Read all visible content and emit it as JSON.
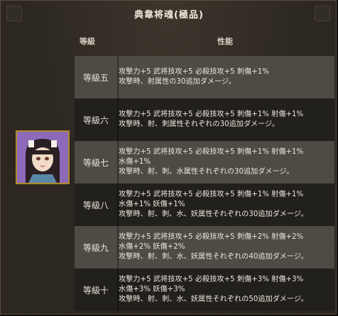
{
  "window": {
    "title": "典韋将魂(極品)"
  },
  "headers": {
    "level": "等級",
    "performance": "性能"
  },
  "portrait": {
    "icon": "character-portrait-icon"
  },
  "rows": [
    {
      "level": "等級五",
      "lines": [
        "攻撃力+5 武将技攻+5 必殺技攻+5 刺傷+1%",
        "攻撃時、射属性の30追加ダメージ。"
      ]
    },
    {
      "level": "等級六",
      "lines": [
        "攻撃力+5 武将技攻+5 必殺技攻+5 刺傷+1% 射傷+1%",
        "攻撃時、射、刺属性それぞれの30追加ダメージ。"
      ]
    },
    {
      "level": "等級七",
      "lines": [
        "攻撃力+5 武将技攻+5 必殺技攻+5 刺傷+1% 射傷+1%",
        "水傷+1%",
        "攻撃時、射、刺、水属性それぞれの30追加ダメージ。"
      ]
    },
    {
      "level": "等級八",
      "lines": [
        "攻撃力+5 武将技攻+5 必殺技攻+5 刺傷+1% 射傷+1%",
        "水傷+1% 妖傷+1%",
        "攻撃時、射、刺、水、妖属性それぞれの30追加ダメージ。"
      ]
    },
    {
      "level": "等級九",
      "lines": [
        "攻撃力+5 武将技攻+5 必殺技攻+5 刺傷+2% 射傷+2%",
        "水傷+2% 妖傷+2%",
        "攻撃時、射、刺、水、妖属性それぞれの40追加ダメージ。"
      ]
    },
    {
      "level": "等級十",
      "lines": [
        "攻撃力+5 武将技攻+5 必殺技攻+5 刺傷+3% 射傷+3%",
        "水傷+3% 妖傷+3%",
        "攻撃時、射、刺、水、妖属性それぞれの50追加ダメージ。"
      ]
    }
  ]
}
